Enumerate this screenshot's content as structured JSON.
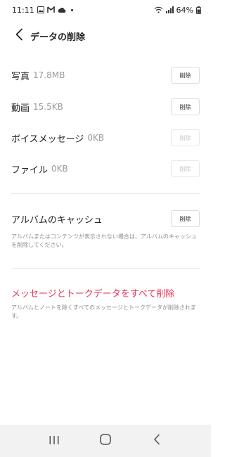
{
  "status_bar": {
    "time": "11:11",
    "battery": "64%",
    "icons_left": [
      "image-icon",
      "mail-icon",
      "cloud-icon",
      "dot-icon"
    ],
    "icons_right": [
      "wifi-icon",
      "signal-icon",
      "battery-icon"
    ]
  },
  "header": {
    "title": "データの削除",
    "back_icon": "back-arrow-icon"
  },
  "items": [
    {
      "label": "写真",
      "size": "17.8MB",
      "button": "削除",
      "enabled": true
    },
    {
      "label": "動画",
      "size": "15.5KB",
      "button": "削除",
      "enabled": true
    },
    {
      "label": "ボイスメッセージ",
      "size": "0KB",
      "button": "削除",
      "enabled": false
    },
    {
      "label": "ファイル",
      "size": "0KB",
      "button": "削除",
      "enabled": false
    }
  ],
  "album_cache": {
    "label": "アルバムのキャッシュ",
    "button": "削除",
    "description": "アルバムまたはコンテンツが表示されない場合は、アルバムのキャッシュを削除してください。"
  },
  "delete_all": {
    "label": "メッセージとトークデータをすべて削除",
    "description": "アルバムとノートを除くすべてのメッセージとトークデータが削除されます。",
    "color": "#e8345a"
  },
  "nav_bar": {
    "icons": [
      "recent-apps-icon",
      "home-icon",
      "back-icon"
    ]
  }
}
